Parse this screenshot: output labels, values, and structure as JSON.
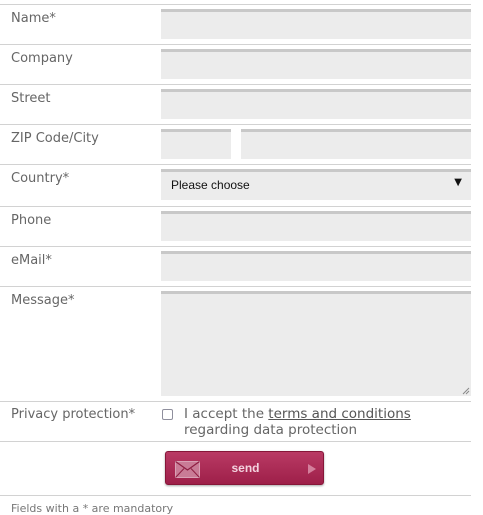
{
  "fields": {
    "name": {
      "label": "Name*",
      "value": ""
    },
    "company": {
      "label": "Company",
      "value": ""
    },
    "street": {
      "label": "Street",
      "value": ""
    },
    "zip_city": {
      "label": "ZIP Code/City",
      "zip_value": "",
      "city_value": ""
    },
    "country": {
      "label": "Country*",
      "selected": "Please choose"
    },
    "phone": {
      "label": "Phone",
      "value": ""
    },
    "email": {
      "label": "eMail*",
      "value": ""
    },
    "message": {
      "label": "Message*",
      "value": ""
    }
  },
  "privacy": {
    "label": "Privacy protection*",
    "checked": false,
    "text_before": "I accept the ",
    "link_text": "terms and conditions",
    "text_after": "regarding data protection"
  },
  "send_button": {
    "label": "send",
    "icon": "envelope-icon",
    "arrow_icon": "play-arrow-icon",
    "color": "#a8284f"
  },
  "footnote": "Fields with a * are mandatory",
  "colors": {
    "input_bg": "#ececec",
    "input_border_top": "#c8c8c8",
    "divider": "#d2d2d2",
    "label": "#666666"
  }
}
